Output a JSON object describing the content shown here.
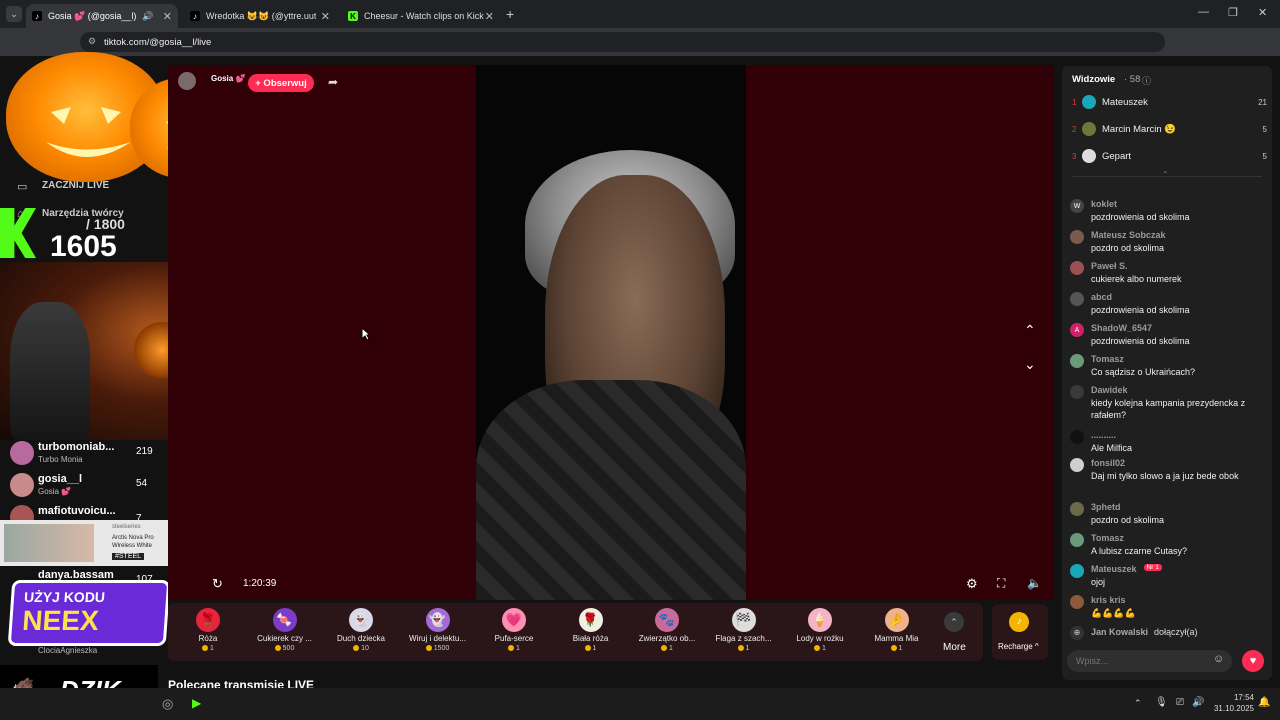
{
  "browser": {
    "tabs": [
      {
        "title": "Gosia 💕 (@gosia__l) pr",
        "icon": "tiktok-icon",
        "active": true
      },
      {
        "title": "Wredotka 😺😺 (@yttre.uuty)",
        "icon": "tiktok-icon",
        "active": false
      },
      {
        "title": "Cheesur - Watch clips on Kick",
        "icon": "kick-icon",
        "active": false
      }
    ],
    "url": "tiktok.com/@gosia__l/live"
  },
  "stream": {
    "host_name": "Gosia 💕",
    "follow_label": "+ Obserwuj",
    "time": "1:20:39",
    "recommended_title": "Polecane transmisje LIVE"
  },
  "sidebar": {
    "items": [
      {
        "label": "ZACZNIJ LIVE"
      },
      {
        "label": "Narzędzia twórcy"
      }
    ],
    "counter": {
      "goal": "/ 1800",
      "value": "1605"
    },
    "live_list": [
      {
        "name": "turbomoniab...",
        "sub": "Turbo Monia",
        "count": "219"
      },
      {
        "name": "gosia__l",
        "sub": "Gosia 💕",
        "count": "54"
      },
      {
        "name": "mafiotuvoicu...",
        "sub": "",
        "count": "7"
      },
      {
        "name": "danya.bassam",
        "sub": "",
        "count": "107"
      },
      {
        "name": "",
        "sub": "ClociaAgnieszka",
        "count": ""
      }
    ],
    "ad": {
      "line1": "Arctis Nova Pro",
      "line2": "Wireless White",
      "brand": "steelseries",
      "code": "#STEEL"
    },
    "promo": {
      "line1": "UŻYJ KODU",
      "line2": "NEEX"
    },
    "logo": "DZIK"
  },
  "gifts": [
    {
      "name": "Róża",
      "price": "1",
      "color": "#e8243c",
      "glyph": "🌹"
    },
    {
      "name": "Cukierek czy ...",
      "price": "500",
      "color": "#7d3cc8",
      "glyph": "🍬"
    },
    {
      "name": "Duch dziecka",
      "price": "10",
      "color": "#d8d8e8",
      "glyph": "👻"
    },
    {
      "name": "Wiruj i delektu...",
      "price": "1500",
      "color": "#a56ad8",
      "glyph": "👻"
    },
    {
      "name": "Pufa-serce",
      "price": "1",
      "color": "#ff8fb5",
      "glyph": "💗"
    },
    {
      "name": "Biała róża",
      "price": "1",
      "color": "#f0f0e0",
      "glyph": "🌹"
    },
    {
      "name": "Zwierzątko ob...",
      "price": "1",
      "color": "#c86a9a",
      "glyph": "🐾"
    },
    {
      "name": "Flaga z szach...",
      "price": "1",
      "color": "#dddddd",
      "glyph": "🏁"
    },
    {
      "name": "Lody w rożku",
      "price": "1",
      "color": "#f5b3c8",
      "glyph": "🍦"
    },
    {
      "name": "Mamma Mia",
      "price": "1",
      "color": "#f0b28a",
      "glyph": "🤌"
    }
  ],
  "more_label": "More",
  "recharge_label": "Recharge ^",
  "chat": {
    "viewers_label": "Widzowie",
    "viewers_count": "· 58",
    "top_viewers": [
      {
        "rank": "1",
        "name": "Mateuszek",
        "count": "21",
        "color": "#1aa8b8"
      },
      {
        "rank": "2",
        "name": "Marcin Marcin 😉",
        "count": "5",
        "color": "#6b7a3a"
      },
      {
        "rank": "3",
        "name": "Gepart",
        "count": "5",
        "color": "#dddddd"
      }
    ],
    "messages": [
      {
        "user": "koklet",
        "text": "pozdrowienia od skolima",
        "av": "W",
        "color": "#444"
      },
      {
        "user": "Mateusz Sobczak",
        "text": "pozdro od skolima",
        "av": "",
        "color": "#7a5a4a"
      },
      {
        "user": "Paweł S.",
        "text": "cukierek albo numerek",
        "av": "",
        "color": "#9a5050"
      },
      {
        "user": "abcd",
        "text": "pozdrowienia od skolima",
        "av": "",
        "color": "#555"
      },
      {
        "user": "ShadoW_6547",
        "text": "pozdrowienia od skolima",
        "av": "A",
        "color": "#d0206a"
      },
      {
        "user": "Tomasz",
        "text": "Co sądzisz o Ukraińcach?",
        "av": "",
        "color": "#6a9a7a"
      },
      {
        "user": "Dawidek",
        "text": "kiedy kolejna kampania prezydencka z rafałem?",
        "av": "",
        "color": "#3a3a3a"
      },
      {
        "user": "..........",
        "text": "Ale Milfica",
        "av": "",
        "color": "#111"
      },
      {
        "user": "fonsil02",
        "text": "Daj mi tylko slowo a ja juz bede obok",
        "av": "",
        "color": "#cfcfcf"
      },
      {
        "user": "3phetd",
        "text": "pozdro od skolima",
        "av": "",
        "color": "#6a6a4a"
      },
      {
        "user": "Tomasz",
        "text": "A lubisz czarne Cutasy?",
        "av": "",
        "color": "#6a9a7a"
      },
      {
        "user": "Mateuszek",
        "text": "ojoj",
        "av": "",
        "color": "#1aa8b8",
        "badge": "Nr 1"
      },
      {
        "user": "kris kris",
        "text": "💪💪💪💪",
        "av": "",
        "color": "#8a5a3a"
      }
    ],
    "joined_user": "Jan Kowalski",
    "joined_text": "dołączył(a)",
    "input_placeholder": "Wpisz..."
  },
  "taskbar": {
    "time": "17:54",
    "date": "31.10.2025"
  }
}
